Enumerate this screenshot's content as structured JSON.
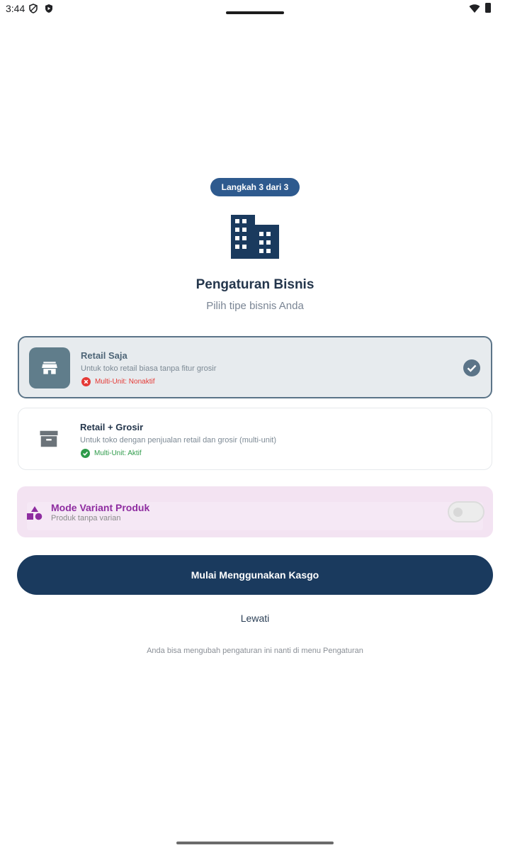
{
  "status_bar": {
    "time": "3:44"
  },
  "onboarding": {
    "step_badge": "Langkah 3 dari 3",
    "title": "Pengaturan Bisnis",
    "subtitle": "Pilih tipe bisnis Anda"
  },
  "business_types": [
    {
      "title": "Retail Saja",
      "description": "Untuk toko retail biasa tanpa fitur grosir",
      "multi_unit": "Multi-Unit: Nonaktif",
      "selected": true
    },
    {
      "title": "Retail + Grosir",
      "description": "Untuk toko dengan penjualan retail dan grosir (multi-unit)",
      "multi_unit": "Multi-Unit: Aktif",
      "selected": false
    }
  ],
  "variant_mode": {
    "title": "Mode Variant Produk",
    "subtitle": "Produk tanpa varian",
    "enabled": false
  },
  "actions": {
    "primary_label": "Mulai Menggunakan Kasgo",
    "skip_label": "Lewati"
  },
  "footnote": "Anda bisa mengubah pengaturan ini nanti di menu Pengaturan",
  "colors": {
    "primary": "#1a3a5e",
    "badge": "#2e5a8e",
    "selected_card": "#e7ebee",
    "variant_accent": "#8e2ca0",
    "status_off": "#e53935",
    "status_on": "#2e9b4a"
  }
}
